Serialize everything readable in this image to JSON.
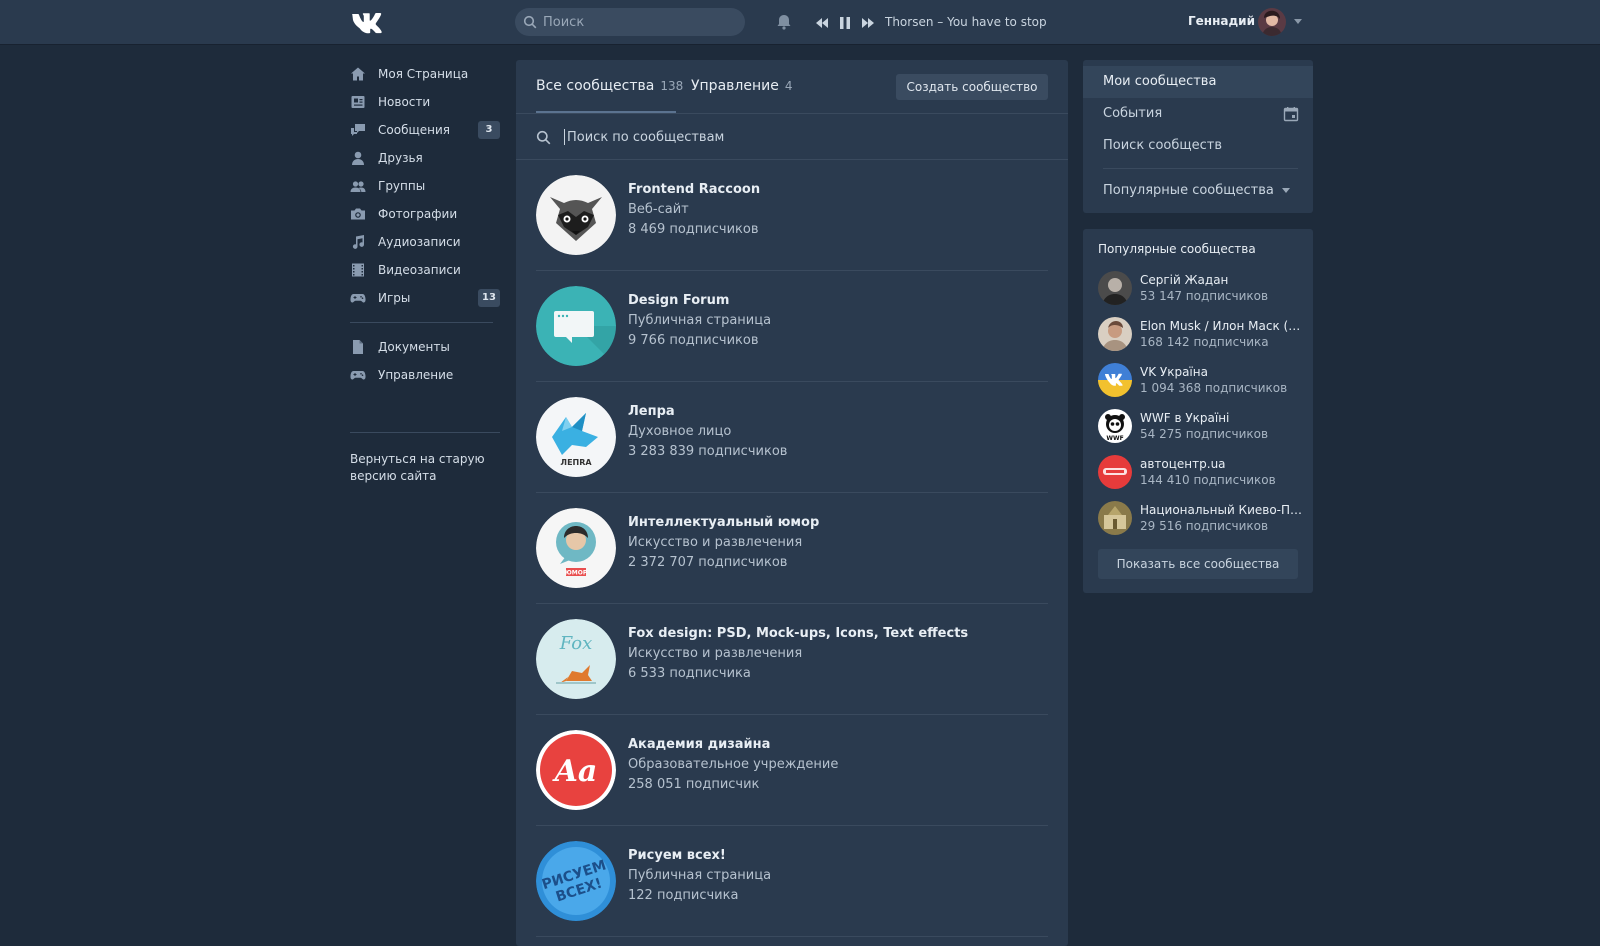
{
  "header": {
    "search_placeholder": "Поиск",
    "track": "Thorsen – You have to stop",
    "user_name": "Геннадий"
  },
  "sidebar": {
    "items": [
      {
        "label": "Моя Страница",
        "icon": "home-icon"
      },
      {
        "label": "Новости",
        "icon": "news-icon"
      },
      {
        "label": "Сообщения",
        "icon": "messages-icon",
        "badge": "3"
      },
      {
        "label": "Друзья",
        "icon": "friend-icon"
      },
      {
        "label": "Группы",
        "icon": "groups-icon"
      },
      {
        "label": "Фотографии",
        "icon": "camera-icon"
      },
      {
        "label": "Аудиозаписи",
        "icon": "music-note-icon"
      },
      {
        "label": "Видеозаписи",
        "icon": "film-icon"
      },
      {
        "label": "Игры",
        "icon": "gamepad-icon",
        "badge": "13"
      },
      {
        "label": "Документы",
        "icon": "document-icon"
      },
      {
        "label": "Управление",
        "icon": "gamepad-icon"
      }
    ],
    "old_version": "Вернуться на старую версию сайта"
  },
  "main": {
    "tabs": [
      {
        "label": "Все сообщества",
        "count": "138"
      },
      {
        "label": "Управление",
        "count": "4"
      }
    ],
    "create_button": "Создать сообщество",
    "search_placeholder": "Поиск по сообществам",
    "communities": [
      {
        "name": "Frontend Raccoon",
        "type": "Веб-сайт",
        "subscribers": "8 469 подписчиков"
      },
      {
        "name": "Design Forum",
        "type": "Публичная страница",
        "subscribers": "9 766 подписчиков"
      },
      {
        "name": "Лепра",
        "type": "Духовное лицо",
        "subscribers": "3 283 839 подписчиков"
      },
      {
        "name": "Интеллектуальный юмор",
        "type": "Искусство и развлечения",
        "subscribers": "2 372 707 подписчиков"
      },
      {
        "name": "Fox design: PSD, Mock-ups, Icons, Text effects",
        "type": "Искусство и развлечения",
        "subscribers": "6 533 подписчика"
      },
      {
        "name": "Академия дизайна",
        "type": "Образовательное учреждение",
        "subscribers": "258 051 подписчик"
      },
      {
        "name": "Рисуем всех!",
        "type": "Публичная страница",
        "subscribers": "122 подписчика"
      }
    ]
  },
  "right_menu": {
    "items": [
      "Мои сообщества",
      "События",
      "Поиск сообществ"
    ],
    "popular_link": "Популярные сообщества"
  },
  "popular": {
    "title": "Популярные сообщества",
    "items": [
      {
        "name": "Сергій Жадан",
        "subscribers": "53 147 подписчиков"
      },
      {
        "name": "Elon Musk / Илон Маск (Sp...",
        "subscribers": "168 142 подписчика"
      },
      {
        "name": "VK Україна",
        "subscribers": "1 094 368 подписчиков"
      },
      {
        "name": "WWF в Україні",
        "subscribers": "54 275 подписчиков"
      },
      {
        "name": "автоцентр.ua",
        "subscribers": "144 410 подписчиков"
      },
      {
        "name": "Национальный Киево-Пе...",
        "subscribers": "29 516 подписчиков"
      }
    ],
    "show_all": "Показать все сообщества"
  },
  "colors": {
    "background": "#1e2b3b",
    "panel": "#2a3a4e",
    "accent": "#5b7390"
  }
}
